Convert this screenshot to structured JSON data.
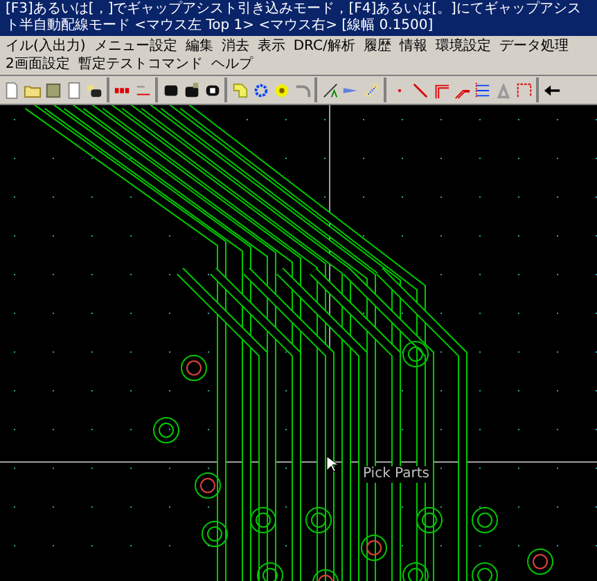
{
  "title": "[F3]あるいは[，]でギャップアシスト引き込みモード，[F4]あるいは[。]にてギャップアシスト半自動配線モード <マウス左 Top 1> <マウス右> [線幅 0.1500]",
  "menu": [
    "イル(入出力)",
    "メニュー設定",
    "編集",
    "消去",
    "表示",
    "DRC/解析",
    "履歴",
    "情報",
    "環境設定",
    "データ処理",
    "2画面設定",
    "暫定テストコマンド",
    "ヘルプ"
  ],
  "canvas": {
    "cursor_label": "Pick Parts"
  }
}
